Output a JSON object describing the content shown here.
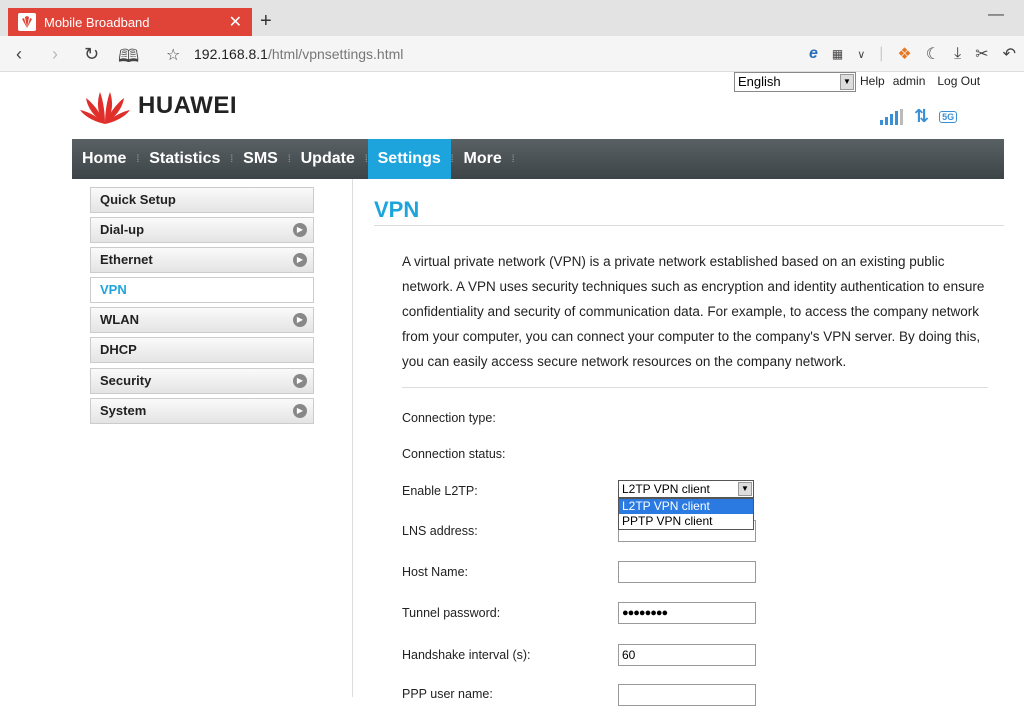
{
  "browser": {
    "tab_title": "Mobile Broadband",
    "tab_close": "✕",
    "new_tab": "+",
    "url_host": "192.168.8.1",
    "url_path": "/html/vpnsettings.html"
  },
  "header": {
    "language": "English",
    "help": "Help",
    "admin": "admin",
    "logout": "Log Out",
    "logo_text": "HUAWEI",
    "network_badge": "5G"
  },
  "nav": {
    "items": [
      "Home",
      "Statistics",
      "SMS",
      "Update",
      "Settings",
      "More"
    ],
    "active": "Settings"
  },
  "sidebar": {
    "items": [
      {
        "label": "Quick Setup",
        "arrow": false
      },
      {
        "label": "Dial-up",
        "arrow": true
      },
      {
        "label": "Ethernet",
        "arrow": true
      },
      {
        "label": "VPN",
        "arrow": false,
        "active": true
      },
      {
        "label": "WLAN",
        "arrow": true
      },
      {
        "label": "DHCP",
        "arrow": false
      },
      {
        "label": "Security",
        "arrow": true
      },
      {
        "label": "System",
        "arrow": true
      }
    ]
  },
  "main": {
    "title": "VPN",
    "description": "A virtual private network (VPN) is a private network established based on an existing public network. A VPN uses security techniques such as encryption and identity authentication to ensure confidentiality and security of communication data. For example, to access the company network from your computer, you can connect your computer to the company's VPN server. By doing this, you can easily access secure network resources on the company network.",
    "fields": {
      "connection_type_label": "Connection type:",
      "connection_type_value": "L2TP VPN client",
      "connection_type_options": [
        "L2TP VPN client",
        "PPTP VPN client"
      ],
      "connection_status_label": "Connection status:",
      "enable_l2tp_label": "Enable L2TP:",
      "lns_address_label": "LNS address:",
      "lns_address_value": "",
      "host_name_label": "Host Name:",
      "host_name_value": "",
      "tunnel_password_label": "Tunnel password:",
      "tunnel_password_value": "●●●●●●●●",
      "handshake_label": "Handshake interval (s):",
      "handshake_value": "60",
      "ppp_user_label": "PPP user name:"
    }
  },
  "colors": {
    "accent": "#1ea4dc",
    "tab_red": "#e04438",
    "nav_dark": "#3d4447"
  }
}
